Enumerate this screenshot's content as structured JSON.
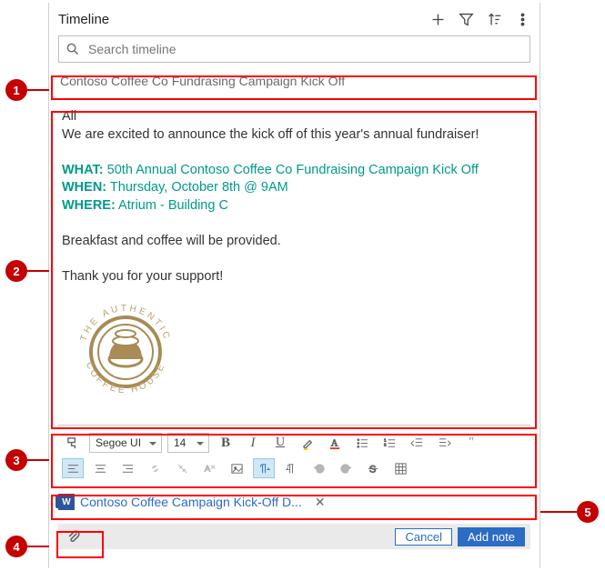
{
  "header": {
    "title": "Timeline"
  },
  "search": {
    "placeholder": "Search timeline"
  },
  "note": {
    "title": "Contoso Coffee Co Fundrasing Campaign Kick Off",
    "body": {
      "greeting": "All",
      "intro": "We are excited to announce the kick off of this year's annual fundraiser!",
      "what_label": "WHAT:",
      "what_value": "50th Annual Contoso Coffee Co Fundraising Campaign Kick Off",
      "when_label": "WHEN:",
      "when_value": "Thursday, October 8th @ 9AM",
      "where_label": "WHERE:",
      "where_value": "Atrium - Building C",
      "closing1": "Breakfast and coffee will be provided.",
      "closing2": "Thank you for your support!",
      "logo_top_text": "THE AUTHENTIC",
      "logo_bottom_text": "COFFEE HOUSE"
    }
  },
  "toolbar": {
    "font_family": "Segoe UI",
    "font_size": "14"
  },
  "attachment": {
    "name": "Contoso Coffee Campaign Kick-Off D..."
  },
  "actions": {
    "cancel": "Cancel",
    "add": "Add note"
  },
  "callouts": {
    "c1": "1",
    "c2": "2",
    "c3": "3",
    "c4": "4",
    "c5": "5"
  }
}
